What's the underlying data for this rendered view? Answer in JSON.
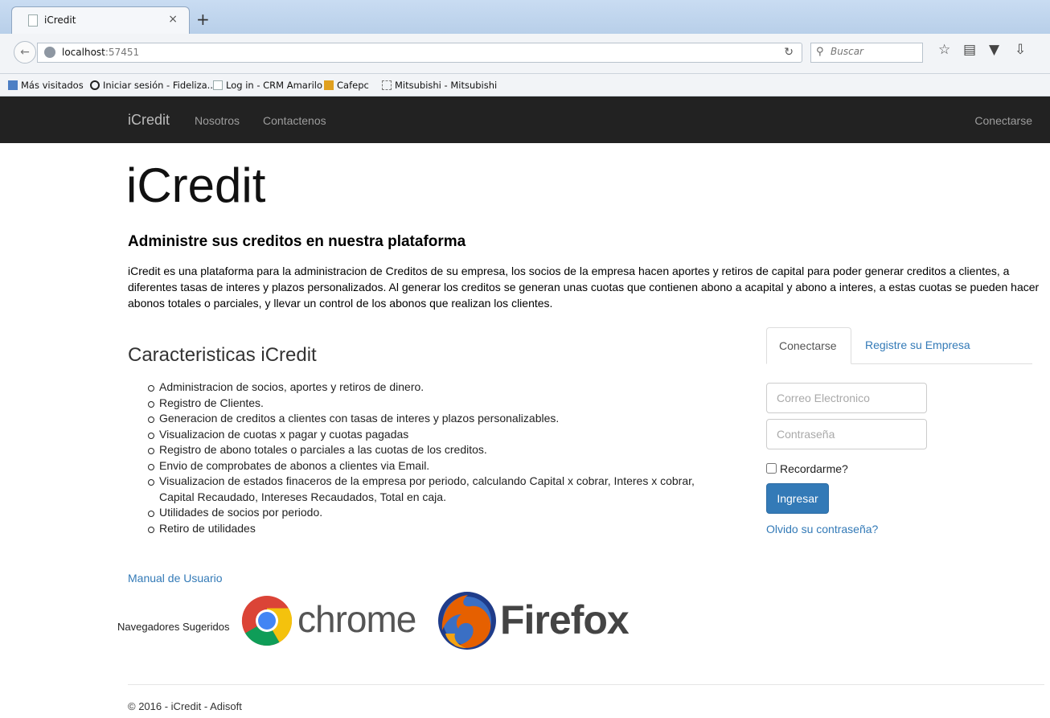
{
  "browser": {
    "tab_title": "iCredit",
    "tab_close": "×",
    "new_tab": "+",
    "url_host": "localhost",
    "url_port": ":57451",
    "search_placeholder": "Buscar",
    "bookmarks": [
      "Más visitados",
      "Iniciar sesión - Fideliza...",
      "Log in - CRM Amarilo",
      "Cafepc",
      "Mitsubishi - Mitsubishi"
    ]
  },
  "site_nav": {
    "brand": "iCredit",
    "links": [
      "Nosotros",
      "Contactenos"
    ],
    "login": "Conectarse"
  },
  "hero": {
    "title": "iCredit",
    "subtitle": "Administre sus creditos en nuestra plataforma",
    "description": "iCredit es una plataforma para la administracion de Creditos de su empresa, los socios de la empresa hacen aportes y retiros de capital para poder generar creditos a clientes, a diferentes tasas de interes y plazos personalizados. Al generar los creditos se generan unas cuotas que contienen abono a acapital y abono a interes, a estas cuotas se pueden hacer abonos totales o parciales, y llevar un control de los abonos que realizan los clientes."
  },
  "features": {
    "heading": "Caracteristicas iCredit",
    "items": [
      "Administracion de socios, aportes y retiros de dinero.",
      "Registro de Clientes.",
      "Generacion de creditos a clientes con tasas de interes y plazos personalizables.",
      "Visualizacion de cuotas x pagar y cuotas pagadas",
      "Registro de abono totales o parciales a las cuotas de los creditos.",
      "Envio de comprobates de abonos a clientes via Email.",
      "Visualizacion de estados finaceros de la empresa por periodo, calculando Capital x cobrar, Interes x cobrar, Capital Recaudado, Intereses Recaudados, Total en caja.",
      "Utilidades de socios por periodo.",
      "Retiro de utilidades"
    ],
    "manual_link": "Manual de Usuario",
    "browsers_label": "Navegadores Sugeridos",
    "chrome_word": "chrome",
    "firefox_word": "Firefox"
  },
  "login": {
    "tab_active": "Conectarse",
    "tab_other": "Registre su Empresa",
    "email_placeholder": "Correo Electronico",
    "password_placeholder": "Contraseña",
    "remember": "Recordarme?",
    "submit": "Ingresar",
    "forgot": "Olvido su contraseña?"
  },
  "footer": {
    "text": "© 2016 - iCredit - Adisoft"
  },
  "colors": {
    "navbar_bg": "#222222",
    "link": "#337ab7",
    "primary_button": "#337ab7"
  }
}
